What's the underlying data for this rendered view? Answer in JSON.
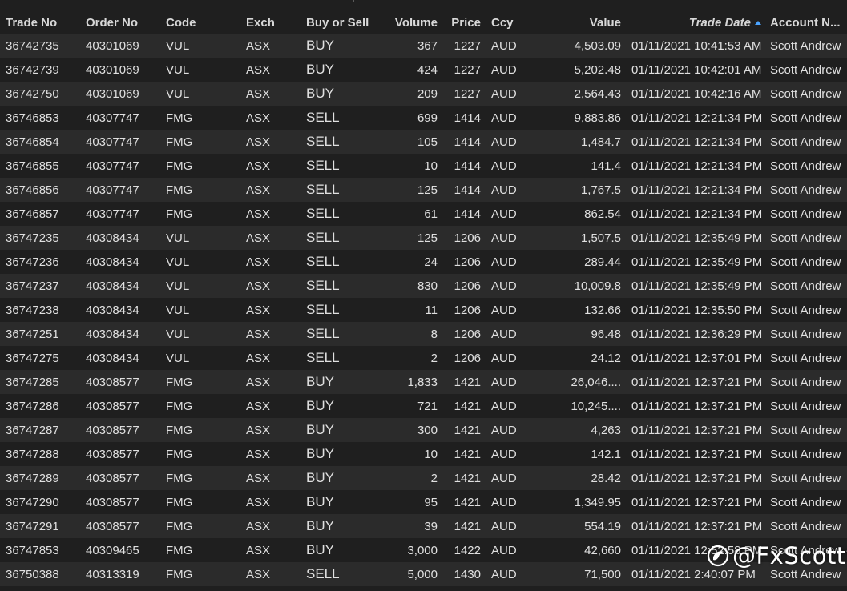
{
  "columns": [
    {
      "key": "trade_no",
      "label": "Trade No"
    },
    {
      "key": "order_no",
      "label": "Order No"
    },
    {
      "key": "code",
      "label": "Code"
    },
    {
      "key": "exch",
      "label": "Exch"
    },
    {
      "key": "side",
      "label": "Buy or Sell"
    },
    {
      "key": "volume",
      "label": "Volume"
    },
    {
      "key": "price",
      "label": "Price"
    },
    {
      "key": "ccy",
      "label": "Ccy"
    },
    {
      "key": "value",
      "label": "Value"
    },
    {
      "key": "trade_date",
      "label": "Trade Date"
    },
    {
      "key": "account",
      "label": "Account N..."
    }
  ],
  "sort": {
    "column": "trade_date",
    "direction": "ascending"
  },
  "colors": {
    "buy": "#9ccc3a",
    "sell": "#ff4a4a",
    "sort_arrow": "#4aa3ff"
  },
  "rows": [
    {
      "trade_no": "36742735",
      "order_no": "40301069",
      "code": "VUL",
      "exch": "ASX",
      "side": "BUY",
      "volume": "367",
      "price": "1227",
      "ccy": "AUD",
      "value": "4,503.09",
      "trade_date": "01/11/2021 10:41:53 AM",
      "account": "Scott Andrew"
    },
    {
      "trade_no": "36742739",
      "order_no": "40301069",
      "code": "VUL",
      "exch": "ASX",
      "side": "BUY",
      "volume": "424",
      "price": "1227",
      "ccy": "AUD",
      "value": "5,202.48",
      "trade_date": "01/11/2021 10:42:01 AM",
      "account": "Scott Andrew"
    },
    {
      "trade_no": "36742750",
      "order_no": "40301069",
      "code": "VUL",
      "exch": "ASX",
      "side": "BUY",
      "volume": "209",
      "price": "1227",
      "ccy": "AUD",
      "value": "2,564.43",
      "trade_date": "01/11/2021 10:42:16 AM",
      "account": "Scott Andrew"
    },
    {
      "trade_no": "36746853",
      "order_no": "40307747",
      "code": "FMG",
      "exch": "ASX",
      "side": "SELL",
      "volume": "699",
      "price": "1414",
      "ccy": "AUD",
      "value": "9,883.86",
      "trade_date": "01/11/2021 12:21:34 PM",
      "account": "Scott Andrew"
    },
    {
      "trade_no": "36746854",
      "order_no": "40307747",
      "code": "FMG",
      "exch": "ASX",
      "side": "SELL",
      "volume": "105",
      "price": "1414",
      "ccy": "AUD",
      "value": "1,484.7",
      "trade_date": "01/11/2021 12:21:34 PM",
      "account": "Scott Andrew"
    },
    {
      "trade_no": "36746855",
      "order_no": "40307747",
      "code": "FMG",
      "exch": "ASX",
      "side": "SELL",
      "volume": "10",
      "price": "1414",
      "ccy": "AUD",
      "value": "141.4",
      "trade_date": "01/11/2021 12:21:34 PM",
      "account": "Scott Andrew"
    },
    {
      "trade_no": "36746856",
      "order_no": "40307747",
      "code": "FMG",
      "exch": "ASX",
      "side": "SELL",
      "volume": "125",
      "price": "1414",
      "ccy": "AUD",
      "value": "1,767.5",
      "trade_date": "01/11/2021 12:21:34 PM",
      "account": "Scott Andrew"
    },
    {
      "trade_no": "36746857",
      "order_no": "40307747",
      "code": "FMG",
      "exch": "ASX",
      "side": "SELL",
      "volume": "61",
      "price": "1414",
      "ccy": "AUD",
      "value": "862.54",
      "trade_date": "01/11/2021 12:21:34 PM",
      "account": "Scott Andrew"
    },
    {
      "trade_no": "36747235",
      "order_no": "40308434",
      "code": "VUL",
      "exch": "ASX",
      "side": "SELL",
      "volume": "125",
      "price": "1206",
      "ccy": "AUD",
      "value": "1,507.5",
      "trade_date": "01/11/2021 12:35:49 PM",
      "account": "Scott Andrew"
    },
    {
      "trade_no": "36747236",
      "order_no": "40308434",
      "code": "VUL",
      "exch": "ASX",
      "side": "SELL",
      "volume": "24",
      "price": "1206",
      "ccy": "AUD",
      "value": "289.44",
      "trade_date": "01/11/2021 12:35:49 PM",
      "account": "Scott Andrew"
    },
    {
      "trade_no": "36747237",
      "order_no": "40308434",
      "code": "VUL",
      "exch": "ASX",
      "side": "SELL",
      "volume": "830",
      "price": "1206",
      "ccy": "AUD",
      "value": "10,009.8",
      "trade_date": "01/11/2021 12:35:49 PM",
      "account": "Scott Andrew"
    },
    {
      "trade_no": "36747238",
      "order_no": "40308434",
      "code": "VUL",
      "exch": "ASX",
      "side": "SELL",
      "volume": "11",
      "price": "1206",
      "ccy": "AUD",
      "value": "132.66",
      "trade_date": "01/11/2021 12:35:50 PM",
      "account": "Scott Andrew"
    },
    {
      "trade_no": "36747251",
      "order_no": "40308434",
      "code": "VUL",
      "exch": "ASX",
      "side": "SELL",
      "volume": "8",
      "price": "1206",
      "ccy": "AUD",
      "value": "96.48",
      "trade_date": "01/11/2021 12:36:29 PM",
      "account": "Scott Andrew"
    },
    {
      "trade_no": "36747275",
      "order_no": "40308434",
      "code": "VUL",
      "exch": "ASX",
      "side": "SELL",
      "volume": "2",
      "price": "1206",
      "ccy": "AUD",
      "value": "24.12",
      "trade_date": "01/11/2021 12:37:01 PM",
      "account": "Scott Andrew"
    },
    {
      "trade_no": "36747285",
      "order_no": "40308577",
      "code": "FMG",
      "exch": "ASX",
      "side": "BUY",
      "volume": "1,833",
      "price": "1421",
      "ccy": "AUD",
      "value": "26,046....",
      "trade_date": "01/11/2021 12:37:21 PM",
      "account": "Scott Andrew"
    },
    {
      "trade_no": "36747286",
      "order_no": "40308577",
      "code": "FMG",
      "exch": "ASX",
      "side": "BUY",
      "volume": "721",
      "price": "1421",
      "ccy": "AUD",
      "value": "10,245....",
      "trade_date": "01/11/2021 12:37:21 PM",
      "account": "Scott Andrew"
    },
    {
      "trade_no": "36747287",
      "order_no": "40308577",
      "code": "FMG",
      "exch": "ASX",
      "side": "BUY",
      "volume": "300",
      "price": "1421",
      "ccy": "AUD",
      "value": "4,263",
      "trade_date": "01/11/2021 12:37:21 PM",
      "account": "Scott Andrew"
    },
    {
      "trade_no": "36747288",
      "order_no": "40308577",
      "code": "FMG",
      "exch": "ASX",
      "side": "BUY",
      "volume": "10",
      "price": "1421",
      "ccy": "AUD",
      "value": "142.1",
      "trade_date": "01/11/2021 12:37:21 PM",
      "account": "Scott Andrew"
    },
    {
      "trade_no": "36747289",
      "order_no": "40308577",
      "code": "FMG",
      "exch": "ASX",
      "side": "BUY",
      "volume": "2",
      "price": "1421",
      "ccy": "AUD",
      "value": "28.42",
      "trade_date": "01/11/2021 12:37:21 PM",
      "account": "Scott Andrew"
    },
    {
      "trade_no": "36747290",
      "order_no": "40308577",
      "code": "FMG",
      "exch": "ASX",
      "side": "BUY",
      "volume": "95",
      "price": "1421",
      "ccy": "AUD",
      "value": "1,349.95",
      "trade_date": "01/11/2021 12:37:21 PM",
      "account": "Scott Andrew"
    },
    {
      "trade_no": "36747291",
      "order_no": "40308577",
      "code": "FMG",
      "exch": "ASX",
      "side": "BUY",
      "volume": "39",
      "price": "1421",
      "ccy": "AUD",
      "value": "554.19",
      "trade_date": "01/11/2021 12:37:21 PM",
      "account": "Scott Andrew"
    },
    {
      "trade_no": "36747853",
      "order_no": "40309465",
      "code": "FMG",
      "exch": "ASX",
      "side": "BUY",
      "volume": "3,000",
      "price": "1422",
      "ccy": "AUD",
      "value": "42,660",
      "trade_date": "01/11/2021 12:52:58 PM",
      "account": "Scott Andrew"
    },
    {
      "trade_no": "36750388",
      "order_no": "40313319",
      "code": "FMG",
      "exch": "ASX",
      "side": "SELL",
      "volume": "5,000",
      "price": "1430",
      "ccy": "AUD",
      "value": "71,500",
      "trade_date": "01/11/2021 2:40:07 PM",
      "account": "Scott Andrew"
    }
  ],
  "watermark": {
    "handle": "@FxScotty",
    "icon": "bird-logo-icon"
  }
}
